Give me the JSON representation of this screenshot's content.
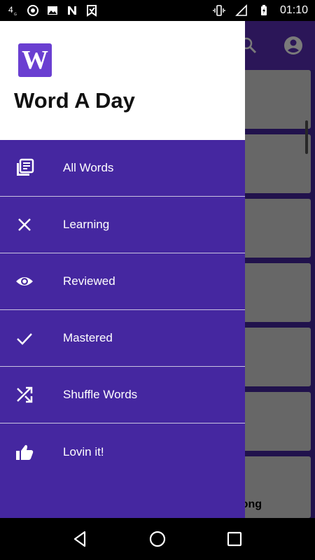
{
  "status_bar": {
    "time": "01:10",
    "left_icons": [
      "4g-icon",
      "chrome-icon",
      "image-icon",
      "n-icon",
      "download-icon"
    ],
    "right_icons": [
      "vibrate-icon",
      "signal-icon",
      "battery-icon"
    ]
  },
  "drawer": {
    "logo_letter": "W",
    "app_title": "Word A Day",
    "items": [
      {
        "label": "All Words",
        "icon": "library-books-icon"
      },
      {
        "label": "Learning",
        "icon": "close-icon"
      },
      {
        "label": "Reviewed",
        "icon": "eye-icon"
      },
      {
        "label": "Mastered",
        "icon": "check-icon"
      },
      {
        "label": "Shuffle Words",
        "icon": "shuffle-icon"
      },
      {
        "label": "Lovin it!",
        "icon": "thumbs-up-icon"
      }
    ]
  },
  "background": {
    "last_card_text": "ong"
  },
  "colors": {
    "drawer_bg": "#4527a0",
    "logo_bg": "#6a3fd1",
    "toolbar_bg": "#5a2fb8"
  }
}
